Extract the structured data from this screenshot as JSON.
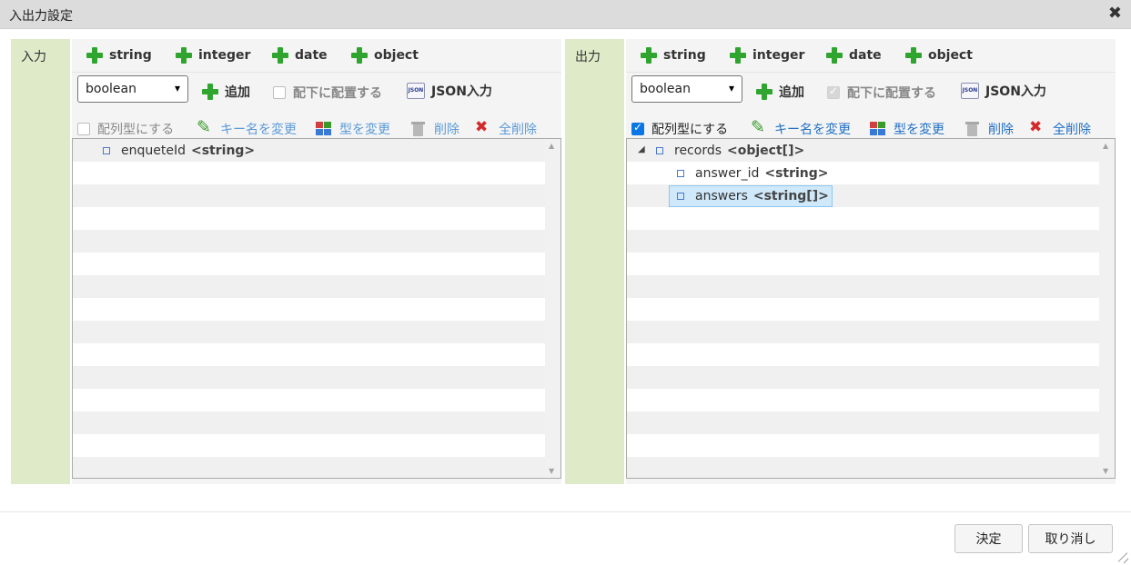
{
  "dialog": {
    "title": "入出力設定",
    "close_icon": "✖"
  },
  "input_panel": {
    "label": "入力",
    "add_types": [
      "string",
      "integer",
      "date",
      "object"
    ],
    "type_select": "boolean",
    "add_label": "追加",
    "place_under": "配下に配置する",
    "json_input": "JSON入力",
    "json_icon_text": "JSON",
    "array_label": "配列型にする",
    "rename_key": "キー名を変更",
    "change_type": "型を変更",
    "delete": "削除",
    "delete_all": "全削除",
    "tree": [
      {
        "name": "enqueteId",
        "type": "<string>"
      }
    ]
  },
  "output_panel": {
    "label": "出力",
    "add_types": [
      "string",
      "integer",
      "date",
      "object"
    ],
    "type_select": "boolean",
    "add_label": "追加",
    "place_under": "配下に配置する",
    "json_input": "JSON入力",
    "json_icon_text": "JSON",
    "array_label": "配列型にする",
    "rename_key": "キー名を変更",
    "change_type": "型を変更",
    "delete": "削除",
    "delete_all": "全削除",
    "tree": [
      {
        "name": "records",
        "type": "<object[]>",
        "expander": "◢"
      },
      {
        "name": "answer_id",
        "type": "<string>"
      },
      {
        "name": "answers",
        "type": "<string[]>"
      }
    ]
  },
  "footer": {
    "ok": "決定",
    "cancel": "取り消し"
  }
}
